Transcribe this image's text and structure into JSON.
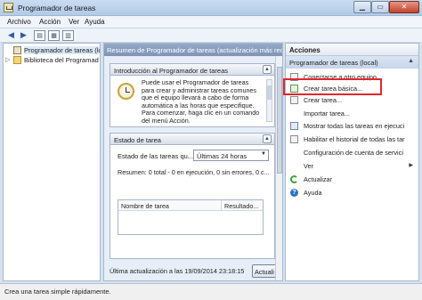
{
  "window": {
    "title": "Programador de tareas"
  },
  "menu": [
    "Archivo",
    "Acción",
    "Ver",
    "Ayuda"
  ],
  "tree": {
    "items": [
      {
        "label": "Programador de tareas (local",
        "expand": "",
        "selected": true,
        "icon": "clock-icon"
      },
      {
        "label": "Biblioteca del Programad",
        "expand": "▷",
        "selected": false,
        "icon": "folder-icon"
      }
    ]
  },
  "middle": {
    "header": "Resumen de Programador de tareas (actualización más recient",
    "intro": {
      "title": "Introducción al Programador de tareas",
      "lines": [
        "Puede usar el Programador de tareas",
        "para crear y administrar tareas comunes",
        "que el equipo llevará a cabo de forma",
        "automática a las horas que especifique.",
        "Para comenzar, haga clic en un comando",
        "del menú Acción."
      ]
    },
    "estado": {
      "title": "Estado de tarea",
      "label": "Estado de las tareas qu...",
      "select_value": "Últimas 24 horas",
      "summary": "Resumen: 0 total - 0 en ejecución, 0 sin errores, 0 c...",
      "columns": [
        "Nombre de tarea",
        "Resultado..."
      ]
    },
    "last_update": "Última actualización a las 19/09/2014 23:18:15",
    "refresh_button": "Actuali"
  },
  "actions": {
    "title": "Acciones",
    "group": "Programador de tareas (local)",
    "items": [
      {
        "label": "Conectarse a otro equipo...",
        "icon": "computer-icon",
        "submenu": false
      },
      {
        "label": "Crear tarea básica...",
        "icon": "basic-task-icon",
        "submenu": false
      },
      {
        "label": "Crear tarea...",
        "icon": "task-icon",
        "submenu": false
      },
      {
        "label": "Importar tarea...",
        "icon": "",
        "submenu": false
      },
      {
        "label": "Mostrar todas las tareas en ejecuci",
        "icon": "list-icon",
        "submenu": false
      },
      {
        "label": "Habilitar el historial de todas las tar",
        "icon": "history-icon",
        "submenu": false
      },
      {
        "label": "Configuración de cuenta de servici",
        "icon": "",
        "submenu": false
      },
      {
        "label": "Ver",
        "icon": "",
        "submenu": true
      },
      {
        "label": "Actualizar",
        "icon": "refresh-icon",
        "submenu": false
      },
      {
        "label": "Ayuda",
        "icon": "help-icon",
        "submenu": false
      }
    ]
  },
  "status": "Crea una tarea simple rápidamente.",
  "colors": {
    "highlight": "#e3262d",
    "header": "#7e95b6",
    "selection": "#dce8f7"
  }
}
